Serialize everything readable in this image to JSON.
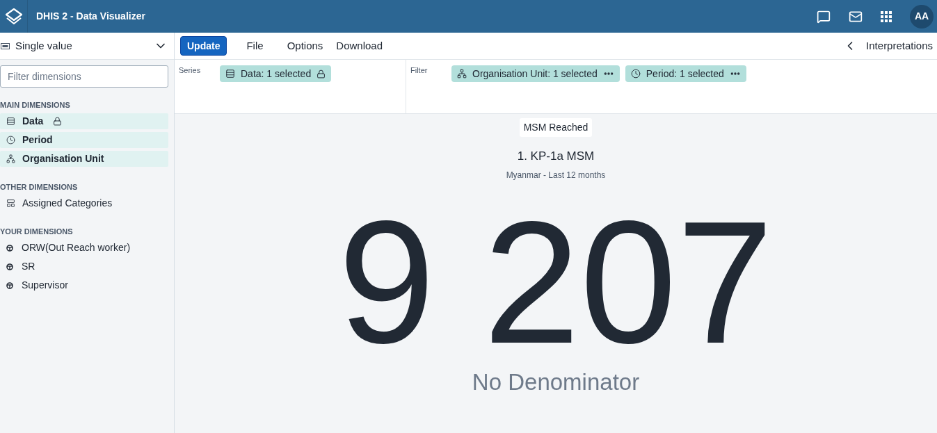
{
  "header": {
    "title": "DHIS 2 - Data Visualizer",
    "avatar": "AA"
  },
  "visualization_type": {
    "label": "Single value"
  },
  "menu": {
    "update": "Update",
    "items": [
      "File",
      "Options",
      "Download"
    ],
    "interpretations": "Interpretations"
  },
  "filter_field": {
    "placeholder": "Filter dimensions"
  },
  "dimension_groups": [
    {
      "heading": "MAIN DIMENSIONS",
      "items": [
        {
          "label": "Data",
          "kind": "data",
          "selected": true,
          "locked": true
        },
        {
          "label": "Period",
          "kind": "period",
          "selected": true,
          "locked": false
        },
        {
          "label": "Organisation Unit",
          "kind": "orgunit",
          "selected": true,
          "locked": false
        }
      ]
    },
    {
      "heading": "OTHER DIMENSIONS",
      "items": [
        {
          "label": "Assigned Categories",
          "kind": "category",
          "selected": false,
          "locked": false
        }
      ]
    },
    {
      "heading": "YOUR DIMENSIONS",
      "items": [
        {
          "label": "ORW(Out Reach worker)",
          "kind": "dynamic",
          "selected": false,
          "locked": false
        },
        {
          "label": "SR",
          "kind": "dynamic",
          "selected": false,
          "locked": false
        },
        {
          "label": "Supervisor",
          "kind": "dynamic",
          "selected": false,
          "locked": false
        }
      ]
    }
  ],
  "layout": {
    "series": {
      "label": "Series",
      "chips": [
        {
          "label": "Data: 1 selected",
          "kind": "data",
          "locked": true
        }
      ]
    },
    "filter": {
      "label": "Filter",
      "chips": [
        {
          "label": "Organisation Unit: 1 selected",
          "kind": "orgunit",
          "locked": false
        },
        {
          "label": "Period: 1 selected",
          "kind": "period",
          "locked": false
        }
      ]
    }
  },
  "visualization": {
    "name": "MSM Reached",
    "title": "1. KP-1a MSM",
    "subtitle": "Myanmar - Last 12 months",
    "value": "9 207",
    "value_caption": "No Denominator"
  }
}
